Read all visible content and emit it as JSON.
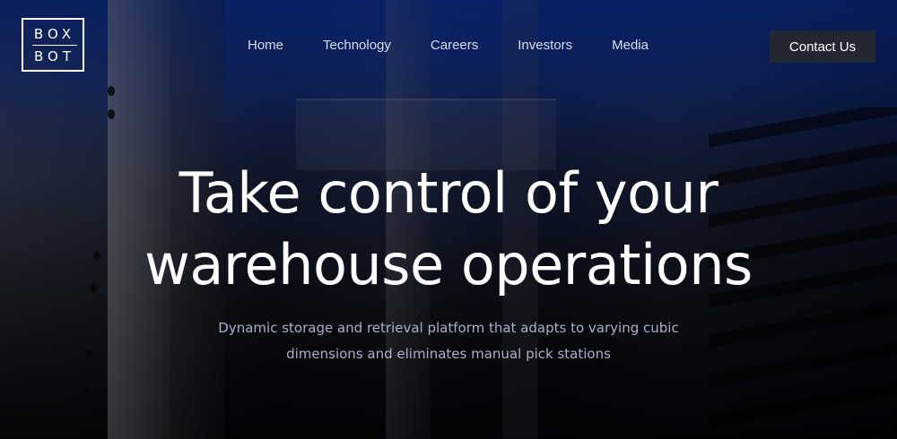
{
  "logo": {
    "line1": "BOX",
    "line2": "BOT"
  },
  "nav": {
    "items": [
      {
        "label": "Home"
      },
      {
        "label": "Technology"
      },
      {
        "label": "Careers"
      },
      {
        "label": "Investors"
      },
      {
        "label": "Media"
      }
    ]
  },
  "header": {
    "contact_label": "Contact Us"
  },
  "hero": {
    "headline_line1": "Take control of your",
    "headline_line2": "warehouse operations",
    "subtitle": "Dynamic storage and retrieval platform that adapts to varying cubic dimensions and eliminates manual pick stations"
  },
  "colors": {
    "accent_blue": "#0c34aa",
    "button_bg": "#232733",
    "nav_text": "#d8deea",
    "subtitle_text": "#a8b2c8"
  }
}
